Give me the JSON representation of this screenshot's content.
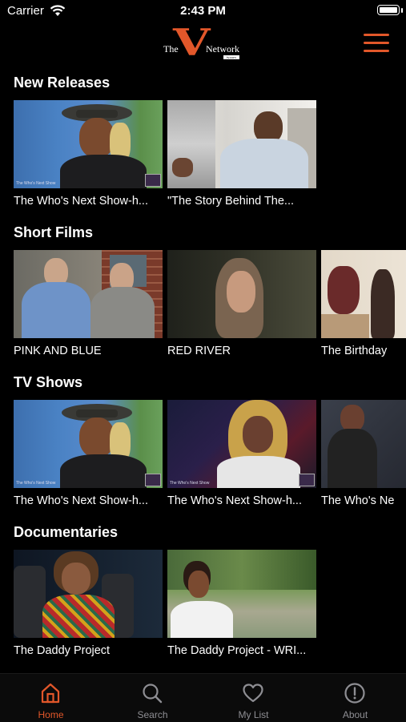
{
  "status_bar": {
    "carrier": "Carrier",
    "time": "2:43 PM"
  },
  "header": {
    "logo_the": "The",
    "logo_v": "V",
    "logo_network": "Network",
    "logo_tag": "tv.com"
  },
  "sections": [
    {
      "title": "New Releases",
      "items": [
        {
          "label": "The Who's Next Show-h...",
          "watermark": "The Who's Next Show"
        },
        {
          "label": "\"The Story Behind The..."
        }
      ]
    },
    {
      "title": "Short Films",
      "items": [
        {
          "label": "PINK AND BLUE"
        },
        {
          "label": "RED RIVER"
        },
        {
          "label": "The Birthday"
        }
      ]
    },
    {
      "title": "TV Shows",
      "items": [
        {
          "label": "The Who's Next Show-h...",
          "watermark": "The Who's Next Show"
        },
        {
          "label": "The Who's Next Show-h...",
          "watermark": "The Who's Next Show"
        },
        {
          "label": "The Who's Ne"
        }
      ]
    },
    {
      "title": "Documentaries",
      "items": [
        {
          "label": "The Daddy Project"
        },
        {
          "label": "The Daddy Project - WRI..."
        }
      ]
    }
  ],
  "tab_bar": {
    "active": "Home",
    "items": [
      {
        "label": "Home",
        "icon": "home-icon"
      },
      {
        "label": "Search",
        "icon": "search-icon"
      },
      {
        "label": "My List",
        "icon": "heart-icon"
      },
      {
        "label": "About",
        "icon": "info-icon"
      }
    ]
  },
  "colors": {
    "accent": "#e2572a",
    "background": "#000000",
    "tab_inactive": "#8e8e93"
  }
}
